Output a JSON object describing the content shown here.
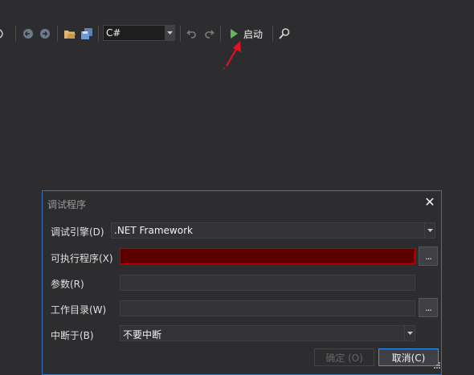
{
  "toolbar": {
    "language": "C#",
    "start_label": "启动"
  },
  "dialog": {
    "title": "调试程序",
    "close": "✕",
    "engine_label": "调试引擎(D)",
    "engine_value": ".NET Framework",
    "exe_label": "可执行程序(X)",
    "exe_value": "",
    "args_label": "参数(R)",
    "args_value": "",
    "workdir_label": "工作目录(W)",
    "workdir_value": "",
    "break_label": "中断于(B)",
    "break_value": "不要中断",
    "browse": "...",
    "ok_label": "确定 (O)",
    "cancel_label": "取消(C)"
  },
  "colors": {
    "accent": "#2f75c2",
    "error_fill": "#5e0000",
    "play_green": "#5fb85f",
    "annotation_arrow": "#e81123"
  }
}
